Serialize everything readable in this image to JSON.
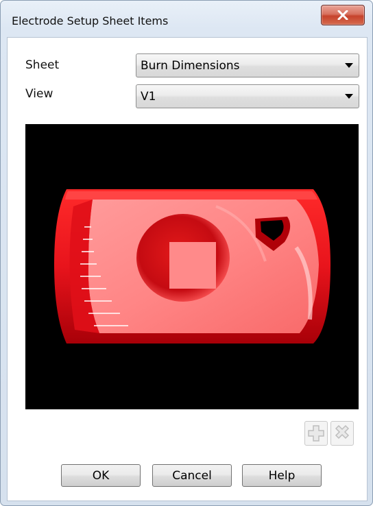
{
  "window": {
    "title": "Electrode Setup Sheet Items",
    "close_icon": "close-x-icon",
    "close_color": "#c6432c"
  },
  "form": {
    "sheet_label": "Sheet",
    "sheet_value": "Burn Dimensions",
    "view_label": "View",
    "view_value": "V1"
  },
  "preview": {
    "background": "#000000",
    "model_color": "#e8141c",
    "model_highlight": "#ff8c8c"
  },
  "toolbar": {
    "add_icon": "add-plus-icon",
    "remove_icon": "remove-x-icon"
  },
  "buttons": {
    "ok": "OK",
    "cancel": "Cancel",
    "help": "Help"
  }
}
